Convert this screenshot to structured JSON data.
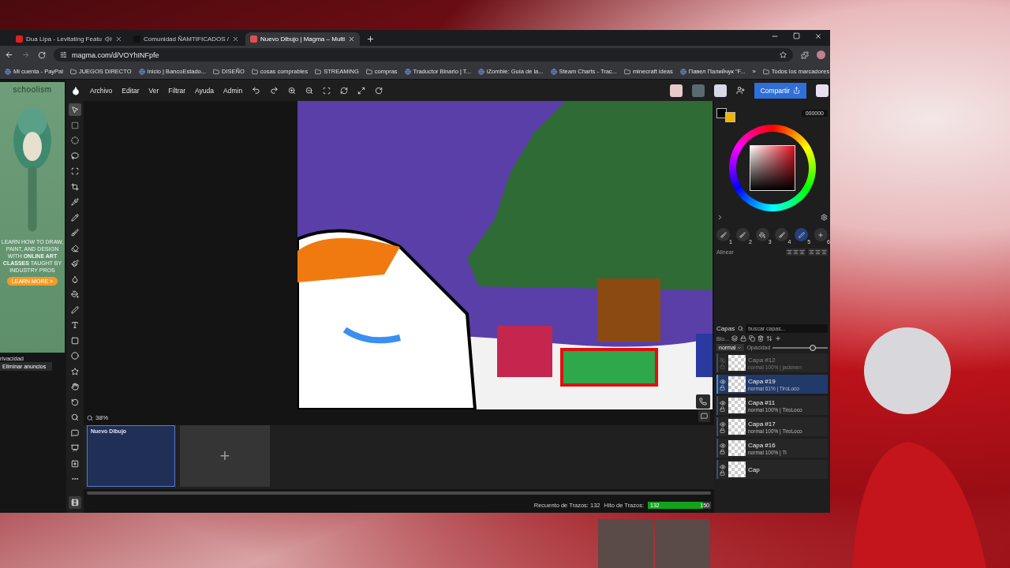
{
  "browser": {
    "tabs": [
      {
        "title": "Dua Lipa - Levitating Featu",
        "audio": true,
        "selected": false
      },
      {
        "title": "Comunidad ÑAMTIFICADOS /",
        "audio": false,
        "selected": false
      },
      {
        "title": "Nuevo Dibujo | Magma – Multi",
        "audio": false,
        "selected": true
      }
    ],
    "url": "magma.com/d/VOYhINFpfe",
    "bookmarks": [
      {
        "label": "Mi cuenta - PayPal",
        "kind": "site"
      },
      {
        "label": "JUEGOS DIRECTO",
        "kind": "folder"
      },
      {
        "label": "Inicio | BancoEstado...",
        "kind": "site"
      },
      {
        "label": "DISEÑO",
        "kind": "folder"
      },
      {
        "label": "cosas comprables",
        "kind": "folder"
      },
      {
        "label": "STREAMING",
        "kind": "folder"
      },
      {
        "label": "compras",
        "kind": "folder"
      },
      {
        "label": "Traductor Binario | T...",
        "kind": "site"
      },
      {
        "label": "iZombie: Guía de la...",
        "kind": "site"
      },
      {
        "label": "Steam Charts - Trac...",
        "kind": "site"
      },
      {
        "label": "minecraft ideas",
        "kind": "folder"
      },
      {
        "label": "Павел Палийчук \"F...",
        "kind": "site"
      }
    ],
    "more_bookmarks": "»",
    "all_bookmarks": "Todos los marcadores"
  },
  "ad": {
    "brand": "schoolism",
    "text": "LEARN HOW TO DRAW, PAINT, AND DESIGN WITH **ONLINE ART CLASSES** TAUGHT BY INDUSTRY PROS",
    "button": "LEARN MORE >",
    "privacy": "rivacidad",
    "remove": "Eliminar anuncios"
  },
  "menu": [
    "Archivo",
    "Editar",
    "Ver",
    "Filtrar",
    "Ayuda",
    "Admin"
  ],
  "share_button": "Compartir",
  "tools": [
    {
      "selected": true
    },
    {
      "selected": false
    },
    {
      "selected": false
    },
    {
      "selected": false
    },
    {
      "selected": false
    },
    {
      "selected": false
    },
    {
      "selected": false
    },
    {
      "selected": false
    },
    {
      "selected": false
    },
    {
      "selected": false
    },
    {
      "selected": false
    },
    {
      "selected": false
    },
    {
      "selected": false
    },
    {
      "selected": false
    },
    {
      "selected": false
    },
    {
      "selected": false
    },
    {
      "selected": false
    },
    {
      "selected": false
    },
    {
      "selected": false
    },
    {
      "selected": false
    },
    {
      "selected": false
    },
    {
      "selected": false
    },
    {
      "selected": false
    },
    {
      "selected": false
    },
    {
      "selected": false
    }
  ],
  "zoom": "38%",
  "documents": [
    {
      "title": "Nuevo Dibujo",
      "selected": true
    }
  ],
  "add_document": "+",
  "status": {
    "count_label": "Recuento de Trazos: 132",
    "milestone_label": "Hito de Trazos:",
    "milestone_value": "132",
    "milestone_max": "150",
    "level": 0.88
  },
  "color": {
    "hex": "000000"
  },
  "brush_slots": [
    {
      "number": "1",
      "kind": "brush",
      "selected": false
    },
    {
      "number": "2",
      "kind": "brush",
      "selected": false
    },
    {
      "number": "3",
      "kind": "bucket",
      "selected": false
    },
    {
      "number": "4",
      "kind": "brush",
      "selected": false
    },
    {
      "number": "5",
      "kind": "pen",
      "selected": true
    },
    {
      "number": "6",
      "kind": "add",
      "selected": false
    }
  ],
  "align_label": "Alinear",
  "layers_panel": {
    "title": "Capas",
    "search_placeholder": "buscar capas...",
    "lock_label": "Blo...",
    "blend": "normal",
    "opacity_label": "Opacidad",
    "level": 0.72
  },
  "layers": [
    {
      "name": "Capa #12",
      "detail": "normal 100% | jackmen",
      "visible": false,
      "selected": false
    },
    {
      "name": "Capa #19",
      "detail": "normal 61% | TiroLoco",
      "visible": true,
      "selected": true
    },
    {
      "name": "Capa #11",
      "detail": "normal 100% | TiroLoco",
      "visible": true,
      "selected": false
    },
    {
      "name": "Capa #17",
      "detail": "normal 100% | TiroLoco",
      "visible": true,
      "selected": false
    },
    {
      "name": "Capa #16",
      "detail": "normal 100% | Ti",
      "visible": true,
      "selected": false
    },
    {
      "name": "Cap",
      "visible": true,
      "selected": false
    }
  ]
}
